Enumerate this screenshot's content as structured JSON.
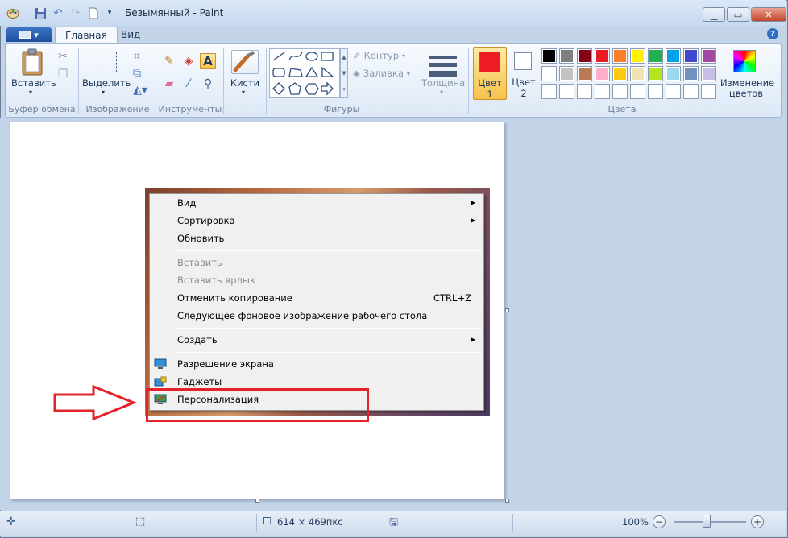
{
  "window": {
    "title": "Безымянный - Paint"
  },
  "tabs": {
    "file": "▾",
    "home": "Главная",
    "view": "Вид"
  },
  "ribbon": {
    "clipboard": {
      "paste": "Вставить",
      "group": "Буфер обмена"
    },
    "image": {
      "select": "Выделить",
      "group": "Изображение"
    },
    "tools": {
      "group": "Инструменты",
      "text_tool": "A"
    },
    "brushes": {
      "label": "Кисти"
    },
    "shapes": {
      "group": "Фигуры",
      "outline": "Контур",
      "fill": "Заливка"
    },
    "size": {
      "label": "Толщина"
    },
    "colors": {
      "color1_label": "Цвет",
      "color1_num": "1",
      "color2_label": "Цвет",
      "color2_num": "2",
      "edit_line1": "Изменение",
      "edit_line2": "цветов",
      "group": "Цвета",
      "color1": "#ed1c24",
      "color2": "#ffffff",
      "palette_row1": [
        "#000000",
        "#7f7f7f",
        "#880015",
        "#ed1c24",
        "#ff7f27",
        "#fff200",
        "#22b14c",
        "#00a2e8",
        "#3f48cc",
        "#a349a4"
      ],
      "palette_row2": [
        "#ffffff",
        "#c3c3c3",
        "#b97a57",
        "#ffaec9",
        "#ffc90e",
        "#efe4b0",
        "#b5e61d",
        "#99d9ea",
        "#7092be",
        "#c8bfe7"
      ],
      "palette_row3": [
        "#ffffff",
        "#ffffff",
        "#ffffff",
        "#ffffff",
        "#ffffff",
        "#ffffff",
        "#ffffff",
        "#ffffff",
        "#ffffff",
        "#ffffff"
      ]
    }
  },
  "context_menu": {
    "items": [
      "Вид",
      "Сортировка",
      "Обновить",
      "Вставить",
      "Вставить ярлык",
      "Отменить копирование",
      "Следующее фоновое изображение рабочего стола",
      "Создать",
      "Разрешение экрана",
      "Гаджеты",
      "Персонализация"
    ],
    "shortcut": "CTRL+Z"
  },
  "status": {
    "dimensions": "614 × 469пкс",
    "zoom": "100%"
  }
}
